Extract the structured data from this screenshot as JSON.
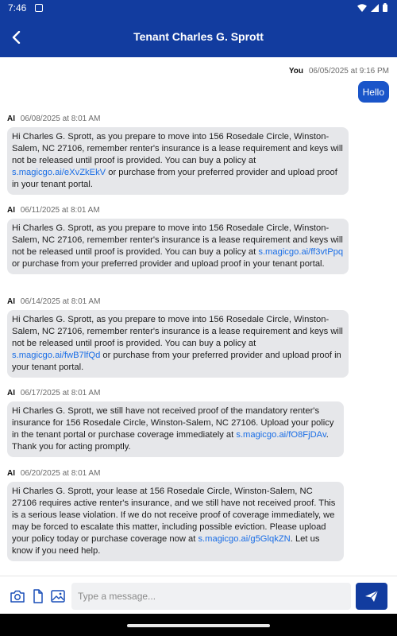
{
  "status_bar": {
    "time": "7:46"
  },
  "header": {
    "title": "Tenant Charles G. Sprott"
  },
  "messages": [
    {
      "sender": "You",
      "timestamp": "06/05/2025 at 9:16 PM",
      "text": "Hello"
    },
    {
      "sender": "AI",
      "timestamp": "06/08/2025 at 8:01 AM",
      "text_before": "Hi Charles G. Sprott, as you prepare to move into 156 Rosedale Circle, Winston-Salem, NC 27106, remember renter's insurance is a lease requirement and keys will not be released until proof is provided. You can buy a policy at ",
      "link": "s.magicgo.ai/eXvZkEkV",
      "text_after": " or purchase from your preferred provider and upload proof in your tenant portal."
    },
    {
      "sender": "AI",
      "timestamp": "06/11/2025 at 8:01 AM",
      "text_before": "Hi Charles G. Sprott, as you prepare to move into 156 Rosedale Circle, Winston-Salem, NC 27106, remember renter's insurance is a lease requirement and keys will not be released until proof is provided. You can buy a policy at ",
      "link": "s.magicgo.ai/ff3vtPpq",
      "text_after": " or purchase from your preferred provider and upload proof in your tenant portal."
    },
    {
      "sender": "AI",
      "timestamp": "06/14/2025 at 8:01 AM",
      "text_before": "Hi Charles G. Sprott, as you prepare to move into 156 Rosedale Circle, Winston-Salem, NC 27106, remember renter's insurance is a lease requirement and keys will not be released until proof is provided. You can buy a policy at ",
      "link": "s.magicgo.ai/fwB7lfQd",
      "text_after": " or purchase from your preferred provider and upload proof in your tenant portal."
    },
    {
      "sender": "AI",
      "timestamp": "06/17/2025 at 8:01 AM",
      "text_before": "Hi Charles G. Sprott, we still have not received proof of the mandatory renter's insurance for 156 Rosedale Circle, Winston-Salem, NC 27106. Upload your policy in the tenant portal or purchase coverage immediately at ",
      "link": "s.magicgo.ai/fO8FjDAv",
      "text_after": ". Thank you for acting promptly."
    },
    {
      "sender": "AI",
      "timestamp": "06/20/2025 at 8:01 AM",
      "text_before": "Hi Charles G. Sprott, your lease at 156 Rosedale Circle, Winston-Salem, NC 27106 requires active renter's insurance, and we still have not received proof. This is a serious lease violation. If we do not receive proof of coverage immediately, we may be forced to escalate this matter, including possible eviction. Please upload your policy today or purchase coverage now at ",
      "link": "s.magicgo.ai/g5GlqkZN",
      "text_after": ". Let us know if you need help."
    }
  ],
  "composer": {
    "placeholder": "Type a message..."
  },
  "icons": {
    "back": "arrow-left-icon",
    "camera": "camera-icon",
    "file": "file-icon",
    "image": "image-icon",
    "send": "send-icon"
  },
  "colors": {
    "primary": "#123c9f",
    "user_bubble": "#1a55c9",
    "ai_bubble": "#e6e7ea",
    "link": "#1a6ee6"
  }
}
